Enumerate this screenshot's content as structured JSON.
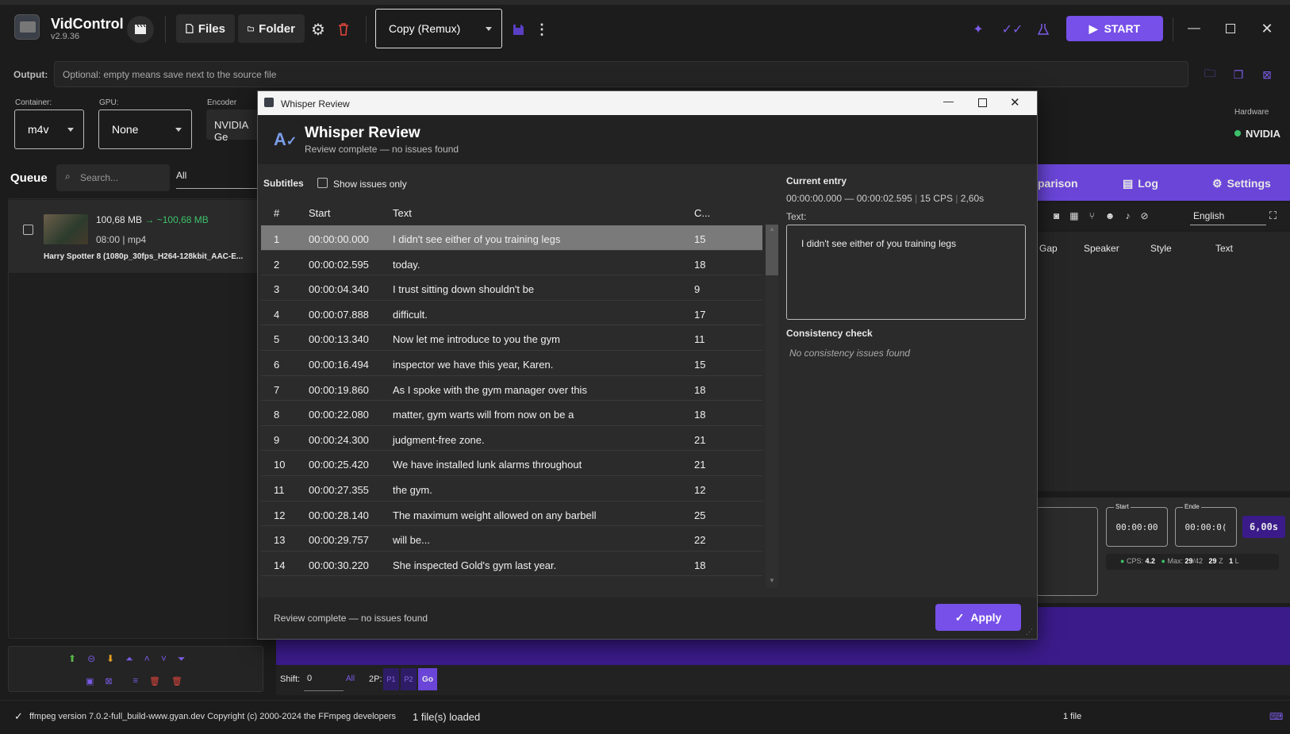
{
  "app": {
    "name": "VidControl",
    "version": "v2.9.36"
  },
  "toolbar": {
    "files": "Files",
    "folder": "Folder",
    "preset": "Copy (Remux)",
    "start": "START"
  },
  "output": {
    "label": "Output:",
    "placeholder": "Optional: empty means save next to the source file"
  },
  "settings": {
    "container_label": "Container:",
    "container": "m4v",
    "gpu_label": "GPU:",
    "gpu": "None",
    "encoder_label": "Encoder",
    "encoder": "NVIDIA Ge",
    "hardware_label": "Hardware",
    "hardware": "NVIDIA"
  },
  "queue": {
    "title": "Queue",
    "search_placeholder": "Search...",
    "filter": "All",
    "item": {
      "size": "100,68 MB",
      "arrow": "→",
      "new_size": "~100,68 MB",
      "duration": "08:00",
      "sep": "|",
      "format": "mp4",
      "name": "Harry Spotter 8 (1080p_30fps_H264-128kbit_AAC-E..."
    }
  },
  "right": {
    "tab_comparison": "parison",
    "tab_log": "Log",
    "tab_settings": "Settings",
    "language": "English",
    "cols": [
      "Gap",
      "Speaker",
      "Style",
      "Text"
    ],
    "start_label": "Start",
    "end_label": "Ende",
    "start_time": "00:00:00",
    "end_time": "00:00:0(",
    "duration": "6,00s",
    "cps_label": "CPS:",
    "cps": "4.2",
    "max_label": "Max:",
    "max": "29",
    "max_of": "/42",
    "z": "29",
    "z_suffix": "Z",
    "l": "1",
    "l_suffix": "L"
  },
  "shift": {
    "label": "Shift:",
    "value": "0",
    "all": "All",
    "twop": "2P:",
    "p1": "P1",
    "p2": "P2",
    "go": "Go"
  },
  "status": {
    "ffmpeg": "ffmpeg version 7.0.2-full_build-www.gyan.dev Copyright (c) 2000-2024 the FFmpeg developers",
    "loaded": "1 file(s) loaded",
    "count": "1 file"
  },
  "dialog": {
    "window_title": "Whisper Review",
    "title": "Whisper Review",
    "subtitle": "Review complete — no issues found",
    "subtitles_label": "Subtitles",
    "show_issues": "Show issues only",
    "columns": {
      "num": "#",
      "start": "Start",
      "text": "Text",
      "cps": "C..."
    },
    "rows": [
      {
        "n": "1",
        "start": "00:00:00.000",
        "text": "I didn't see either of you training legs",
        "c": "15"
      },
      {
        "n": "2",
        "start": "00:00:02.595",
        "text": "today.",
        "c": "18"
      },
      {
        "n": "3",
        "start": "00:00:04.340",
        "text": "I trust sitting down shouldn't be",
        "c": "9"
      },
      {
        "n": "4",
        "start": "00:00:07.888",
        "text": "difficult.",
        "c": "17"
      },
      {
        "n": "5",
        "start": "00:00:13.340",
        "text": "Now let me introduce to you the gym",
        "c": "11"
      },
      {
        "n": "6",
        "start": "00:00:16.494",
        "text": "inspector we have this year, Karen.",
        "c": "15"
      },
      {
        "n": "7",
        "start": "00:00:19.860",
        "text": "As I spoke with the gym manager over this",
        "c": "18"
      },
      {
        "n": "8",
        "start": "00:00:22.080",
        "text": "matter, gym warts will from now on be a",
        "c": "18"
      },
      {
        "n": "9",
        "start": "00:00:24.300",
        "text": "judgment-free zone.",
        "c": "21"
      },
      {
        "n": "10",
        "start": "00:00:25.420",
        "text": "We have installed lunk alarms throughout",
        "c": "21"
      },
      {
        "n": "11",
        "start": "00:00:27.355",
        "text": "the gym.",
        "c": "12"
      },
      {
        "n": "12",
        "start": "00:00:28.140",
        "text": "The maximum weight allowed on any barbell",
        "c": "25"
      },
      {
        "n": "13",
        "start": "00:00:29.757",
        "text": "will be...",
        "c": "22"
      },
      {
        "n": "14",
        "start": "00:00:30.220",
        "text": "She inspected Gold's gym last year.",
        "c": "18"
      }
    ],
    "current_entry_label": "Current entry",
    "current_range": "00:00:00.000 — 00:00:02.595",
    "current_cps": "15 CPS",
    "current_dur": "2,60s",
    "text_label": "Text:",
    "current_text": "I didn't see either of you training legs",
    "consistency_label": "Consistency check",
    "consistency_result": "No consistency issues found",
    "footer_status": "Review complete — no issues found",
    "apply": "Apply"
  }
}
